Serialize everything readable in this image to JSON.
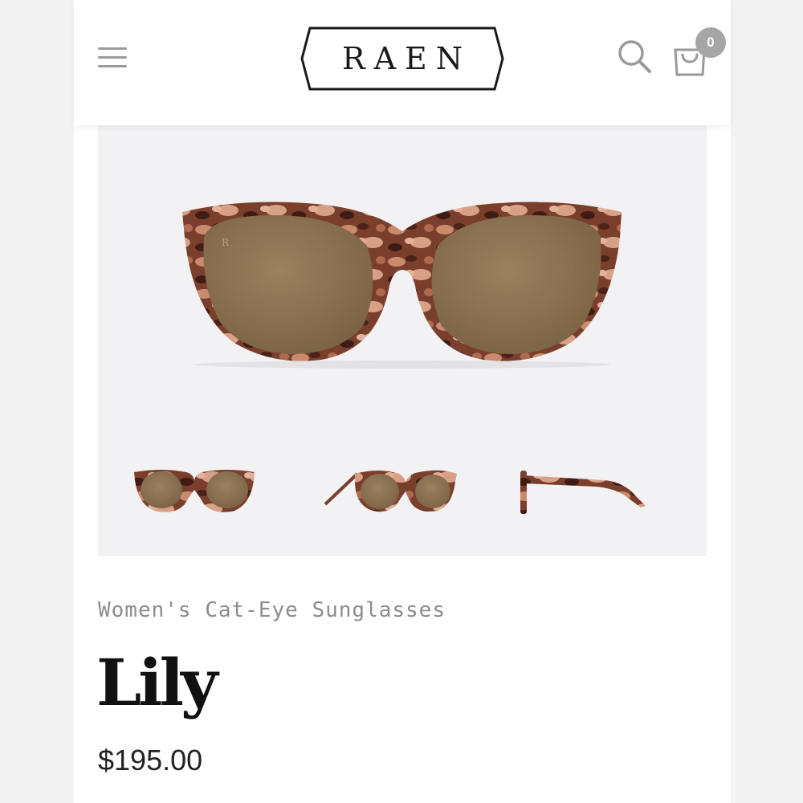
{
  "header": {
    "logo_text": "RAEN",
    "cart_count": "0",
    "menu_icon": "hamburger-menu-icon",
    "search_icon": "search-icon",
    "cart_icon": "shopping-bag-icon"
  },
  "product": {
    "category": "Women's Cat-Eye Sunglasses",
    "name": "Lily",
    "price": "$195.00",
    "frame_color": "#8a4b35",
    "lens_color": "#8b7350"
  },
  "colors": {
    "page_background": "#f3f3f4",
    "gallery_background": "#f2f1f3",
    "badge": "#a6a6a6",
    "icon_gray": "#9a9a9a"
  }
}
